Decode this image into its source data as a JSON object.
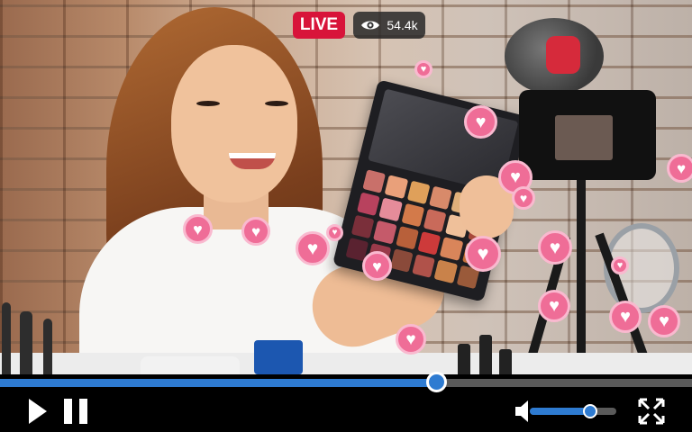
{
  "video": {
    "live_label": "LIVE",
    "viewer_count": "54.4k",
    "viewer_icon": "eye-icon"
  },
  "player": {
    "progress": 0.63,
    "volume": 0.7,
    "controls": {
      "play_icon": "play-icon",
      "pause_icon": "pause-icon",
      "volume_icon": "volume-icon",
      "fullscreen_icon": "fullscreen-icon"
    }
  },
  "colors": {
    "live_red": "#d8143a",
    "accent_blue": "#2e7bd1",
    "heart_pink": "#ef6d97"
  },
  "reaction_icon": "heart-icon"
}
